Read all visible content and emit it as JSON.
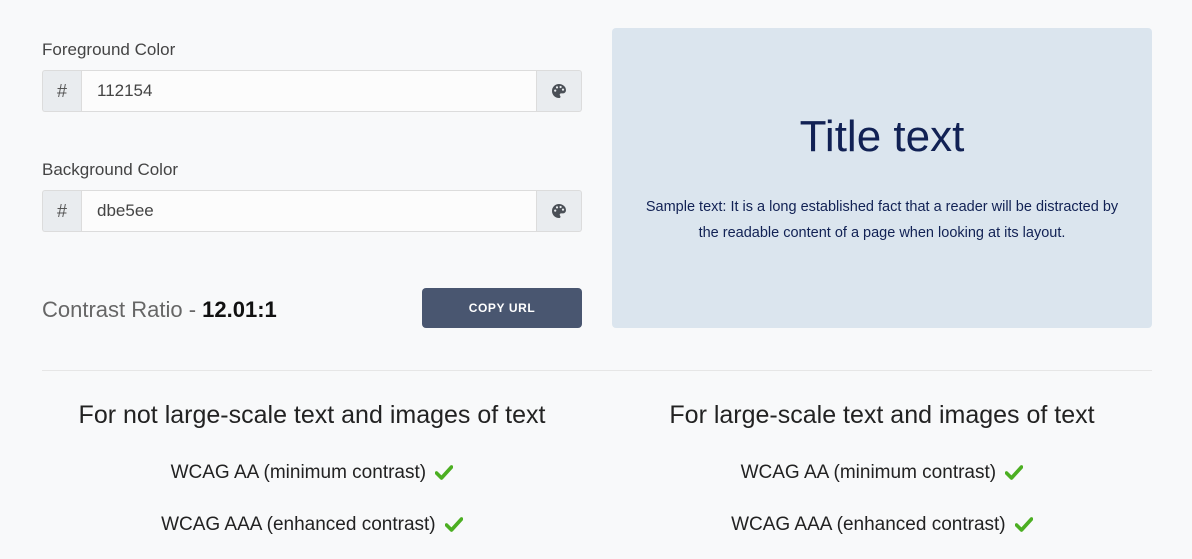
{
  "foreground": {
    "label": "Foreground Color",
    "prefix": "#",
    "value": "112154",
    "hex": "#112154"
  },
  "background": {
    "label": "Background Color",
    "prefix": "#",
    "value": "dbe5ee",
    "hex": "#dbe5ee"
  },
  "contrast": {
    "label": "Contrast Ratio - ",
    "value": "12.01:1"
  },
  "copy_button": {
    "label": "COPY URL",
    "color": "#495670"
  },
  "preview": {
    "title": "Title text",
    "sample": "Sample text: It is a long established fact that a reader will be distracted by the readable content of a page when looking at its layout."
  },
  "sections": [
    {
      "title": "For not large-scale text and images of text",
      "criteria": [
        {
          "label": "WCAG AA (minimum contrast)",
          "status": "pass",
          "icon": "check-icon"
        },
        {
          "label": "WCAG AAA (enhanced contrast)",
          "status": "pass",
          "icon": "check-icon"
        }
      ]
    },
    {
      "title": "For large-scale text and images of text",
      "criteria": [
        {
          "label": "WCAG AA (minimum contrast)",
          "status": "pass",
          "icon": "check-icon"
        },
        {
          "label": "WCAG AAA (enhanced contrast)",
          "status": "pass",
          "icon": "check-icon"
        }
      ]
    }
  ],
  "pass_color": "#4caf22"
}
